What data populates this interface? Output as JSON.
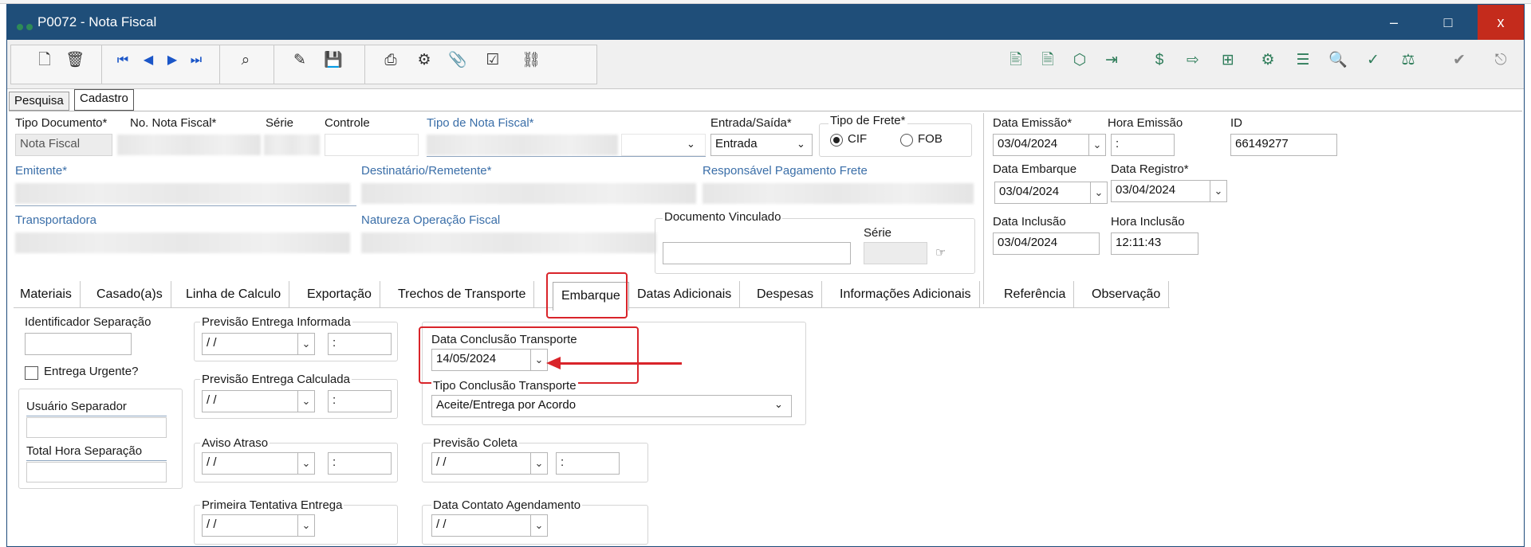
{
  "window": {
    "title": "P0072 - Nota Fiscal",
    "minimize": "–",
    "maximize": "□",
    "close": "x"
  },
  "toolbar": {
    "left_icons": [
      "new-document-icon",
      "delete-icon",
      "first-record-icon",
      "previous-record-icon",
      "next-record-icon",
      "last-record-icon",
      "search-record-icon",
      "edit-icon",
      "save-icon",
      "print-icon",
      "settings-icon",
      "attach-icon",
      "confirm-check-icon",
      "link-icon"
    ],
    "right_icons": [
      "truck-report-icon",
      "invoice-config-icon",
      "package-icon",
      "import-icon",
      "money-doc-icon",
      "export-doc-icon",
      "tree-icon",
      "process-gear-icon",
      "list-doc-icon",
      "preview-doc-icon",
      "approve-doc-icon",
      "scale-icon",
      "check-icon",
      "exit-icon"
    ]
  },
  "page_tabs": [
    "Pesquisa",
    "Cadastro"
  ],
  "header": {
    "tipo_documento_label": "Tipo Documento*",
    "tipo_documento_value": "Nota Fiscal",
    "no_nota_label": "No. Nota Fiscal*",
    "serie_label": "Série",
    "controle_label": "Controle",
    "tipo_nota_label": "Tipo de Nota Fiscal*",
    "entrada_saida_label": "Entrada/Saída*",
    "entrada_saida_value": "Entrada",
    "tipo_frete_label": "Tipo de Frete*",
    "frete_cif": "CIF",
    "frete_fob": "FOB",
    "data_emissao_label": "Data Emissão*",
    "data_emissao_value": "03/04/2024",
    "hora_emissao_label": "Hora Emissão",
    "hora_emissao_value": ":",
    "id_label": "ID",
    "id_value": "66149277",
    "emitente_label": "Emitente*",
    "destinatario_label": "Destinatário/Remetente*",
    "responsavel_label": "Responsável Pagamento Frete",
    "data_embarque_label": "Data Embarque",
    "data_embarque_value": "03/04/2024",
    "data_registro_label": "Data Registro*",
    "data_registro_value": "03/04/2024",
    "transportadora_label": "Transportadora",
    "natureza_label": "Natureza Operação Fiscal",
    "doc_vinculado_label": "Documento Vinculado",
    "doc_serie_label": "Série",
    "data_inclusao_label": "Data Inclusão",
    "data_inclusao_value": "03/04/2024",
    "hora_inclusao_label": "Hora Inclusão",
    "hora_inclusao_value": "12:11:43"
  },
  "tabs": [
    "Materiais",
    "Casado(a)s",
    "Linha de Calculo",
    "Exportação",
    "Trechos de Transporte",
    "Embarque",
    "Datas Adicionais",
    "Despesas",
    "Informações Adicionais",
    "Referência",
    "Observação"
  ],
  "embarque": {
    "identificador_label": "Identificador Separação",
    "entrega_urgente_label": "Entrega Urgente?",
    "usuario_separador_label": "Usuário Separador",
    "total_hora_label": "Total Hora Separação",
    "prev_informada_label": "Previsão Entrega Informada",
    "prev_calculada_label": "Previsão Entrega Calculada",
    "aviso_atraso_label": "Aviso Atraso",
    "primeira_tentativa_label": "Primeira Tentativa Entrega",
    "empty_date": "/ /",
    "empty_time": ":",
    "data_conclusao_label": "Data Conclusão Transporte",
    "data_conclusao_value": "14/05/2024",
    "tipo_conclusao_label": "Tipo Conclusão Transporte",
    "tipo_conclusao_value": "Aceite/Entrega por Acordo",
    "previsao_coleta_label": "Previsão Coleta",
    "data_contato_label": "Data Contato Agendamento"
  },
  "colors": {
    "titlebar": "#1f4e79",
    "close": "#c42b1c",
    "highlight": "#d9242a",
    "label_blue": "#3a6ea8"
  }
}
